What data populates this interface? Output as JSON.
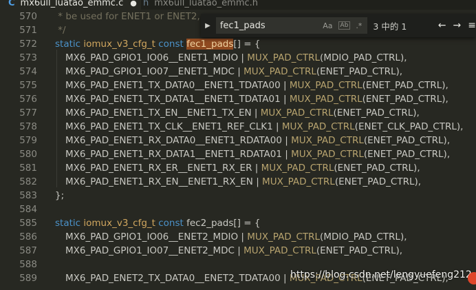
{
  "tabs": [
    {
      "label": "mx6ull_luatao_emmc.c",
      "icon": "c-file-icon",
      "modified_mark": "●"
    },
    {
      "label": "mx6ull_luatao_emmc.h",
      "icon": "header-file-icon"
    }
  ],
  "find": {
    "toggle_icon": "chevron-right-icon",
    "query": "fec1_pads",
    "match_case": "Aa",
    "whole_word": "Ab",
    "regex": ".*",
    "match_count": "3 中的 1",
    "prev_icon": "arrow-left-icon",
    "next_icon": "arrow-right-icon",
    "more_icon": "menu-icon"
  },
  "gutter": [
    "570",
    "571",
    "572",
    "573",
    "574",
    "575",
    "576",
    "577",
    "578",
    "579",
    "580",
    "581",
    "582",
    "583",
    "584",
    "585",
    "586",
    "587",
    "588",
    "589"
  ],
  "code": {
    "l570": " * be used for ENET1 or ENET2,",
    "l571": " */",
    "kw_static": "static",
    "type_cfg": "iomux_v3_cfg_t",
    "kw_const": "const",
    "fec1_name": "fec1_pads",
    "decl_tail": "[] = {",
    "fec2_name": "fec2_pads",
    "close": "};",
    "mux": "MUX_PAD_CTRL",
    "fec1_rows": [
      {
        "pad": "MX6_PAD_GPIO1_IO06__ENET1_MDIO",
        "arg": "MDIO_PAD_CTRL"
      },
      {
        "pad": "MX6_PAD_GPIO1_IO07__ENET1_MDC",
        "arg": "ENET_PAD_CTRL"
      },
      {
        "pad": "MX6_PAD_ENET1_TX_DATA0__ENET1_TDATA00",
        "arg": "ENET_PAD_CTRL"
      },
      {
        "pad": "MX6_PAD_ENET1_TX_DATA1__ENET1_TDATA01",
        "arg": "ENET_PAD_CTRL"
      },
      {
        "pad": "MX6_PAD_ENET1_TX_EN__ENET1_TX_EN",
        "arg": "ENET_PAD_CTRL"
      },
      {
        "pad": "MX6_PAD_ENET1_TX_CLK__ENET1_REF_CLK1",
        "arg": "ENET_CLK_PAD_CTRL"
      },
      {
        "pad": "MX6_PAD_ENET1_RX_DATA0__ENET1_RDATA00",
        "arg": "ENET_PAD_CTRL"
      },
      {
        "pad": "MX6_PAD_ENET1_RX_DATA1__ENET1_RDATA01",
        "arg": "ENET_PAD_CTRL"
      },
      {
        "pad": "MX6_PAD_ENET1_RX_ER__ENET1_RX_ER",
        "arg": "ENET_PAD_CTRL"
      },
      {
        "pad": "MX6_PAD_ENET1_RX_EN__ENET1_RX_EN",
        "arg": "ENET_PAD_CTRL"
      }
    ],
    "fec2_rows": [
      {
        "pad": "MX6_PAD_GPIO1_IO06__ENET2_MDIO",
        "arg": "MDIO_PAD_CTRL"
      },
      {
        "pad": "MX6_PAD_GPIO1_IO07__ENET2_MDC",
        "arg": "ENET_PAD_CTRL"
      },
      {
        "pad": "MX6_PAD_ENET2_TX_DATA0__ENET2_TDATA00",
        "arg": "ENET_PAD_CTRL"
      }
    ]
  },
  "watermark": "https://blog.csdn.net/lengyuefeng212"
}
